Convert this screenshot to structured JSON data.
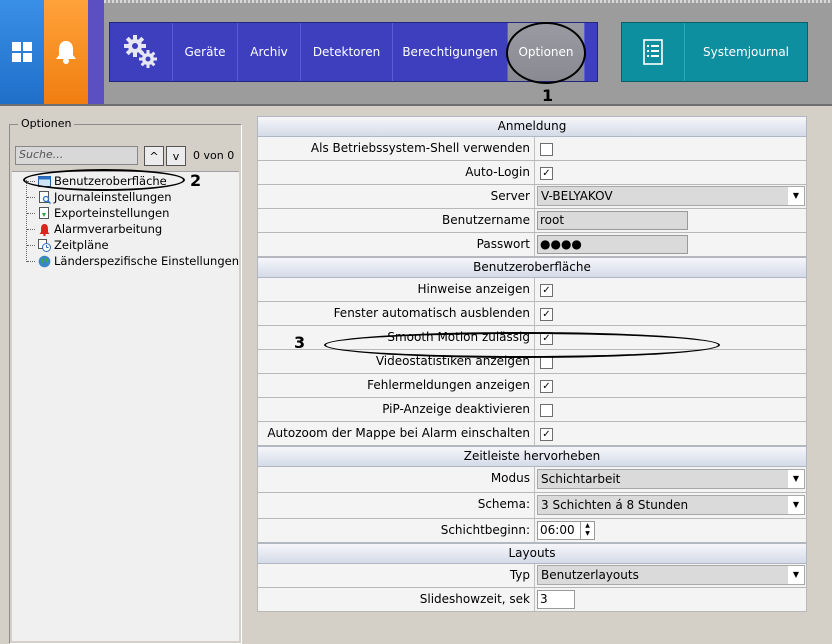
{
  "topbar": {
    "nav_items": [
      "Geräte",
      "Archiv",
      "Detektoren",
      "Berechtigungen",
      "Optionen"
    ],
    "journal_label": "Systemjournal",
    "icons": [
      "windows-icon",
      "bell-icon",
      "gears-icon",
      "journal-icon"
    ]
  },
  "annotations": {
    "n1": "1",
    "n2": "2",
    "n3": "3"
  },
  "left": {
    "title": "Optionen",
    "search_placeholder": "Suche...",
    "up": "^",
    "down": "v",
    "count": "0 von 0",
    "tree": [
      "Benutzeroberfläche",
      "Journaleinstellungen",
      "Exporteinstellungen",
      "Alarmverarbeitung",
      "Zeitpläne",
      "Länderspezifische Einstellungen"
    ]
  },
  "grid": {
    "anmeldung": {
      "header": "Anmeldung",
      "shell": "Als Betriebssystem-Shell verwenden",
      "autologin": "Auto-Login",
      "server": "Server",
      "server_value": "V-BELYAKOV",
      "user": "Benutzername",
      "user_value": "root",
      "pass": "Passwort",
      "pass_value": "●●●●"
    },
    "ui": {
      "header": "Benutzeroberfläche",
      "hints": "Hinweise anzeigen",
      "autohide": "Fenster automatisch ausblenden",
      "smooth": "Smooth Motion zulässig",
      "videostats": "Videostatistiken anzeigen",
      "errors": "Fehlermeldungen anzeigen",
      "pip": "PiP-Anzeige deaktivieren",
      "autozoom": "Autozoom der Mappe bei Alarm einschalten"
    },
    "timeline": {
      "header": "Zeitleiste hervorheben",
      "mode": "Modus",
      "mode_value": "Schichtarbeit",
      "schema": "Schema:",
      "schema_value": "3 Schichten á 8 Stunden",
      "start": "Schichtbeginn:",
      "start_value": "06:00"
    },
    "layouts": {
      "header": "Layouts",
      "type": "Typ",
      "type_value": "Benutzerlayouts",
      "slide": "Slideshowzeit, sek",
      "slide_value": "3"
    }
  },
  "checkbox_states": {
    "shell": false,
    "autologin": true,
    "hints": true,
    "autohide": true,
    "smooth": true,
    "videostats": false,
    "errors": true,
    "pip": false,
    "autozoom": true
  },
  "colors": {
    "nav_blue": "#3d3fbf",
    "journal_teal": "#0e8fa0",
    "win_blue": "#2a7fd9",
    "bell_orange": "#f7901e"
  }
}
